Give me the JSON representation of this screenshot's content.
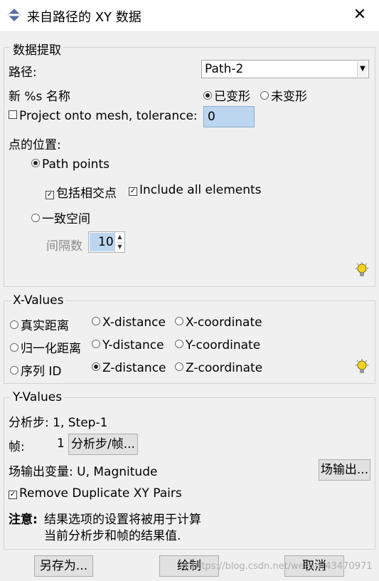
{
  "window": {
    "title": "来自路径的 XY 数据",
    "close": "✕"
  },
  "extract": {
    "legend": "数据提取",
    "path_label": "路径:",
    "path_value": "Path-2",
    "name_label": "新 %s 名称",
    "deformed": "已变形",
    "undeformed": "未变形",
    "project_label": "Project onto mesh, tolerance:",
    "tolerance": "0",
    "points_label": "点的位置:",
    "path_points": "Path points",
    "include_intersections": "包括相交点",
    "include_all_elements": "Include all elements",
    "uniform_spacing": "一致空间",
    "interval_label": "间隔数",
    "interval_value": "10"
  },
  "xvalues": {
    "legend": "X-Values",
    "options": [
      "真实距离",
      "X-distance",
      "X-coordinate",
      "归一化距离",
      "Y-distance",
      "Y-coordinate",
      "序列 ID",
      "Z-distance",
      "Z-coordinate"
    ],
    "selected": "Z-distance"
  },
  "yvalues": {
    "legend": "Y-Values",
    "step_text": "分析步: 1, Step-1",
    "frame_label": "帧:",
    "frame_value": "1",
    "step_frame_button": "分析步/帧...",
    "field_var_text": "场输出变量: U, Magnitude",
    "field_output_button": "场输出...",
    "remove_duplicates": "Remove Duplicate XY Pairs",
    "note_label": "注意:",
    "note_line1": "结果选项的设置将被用于计算",
    "note_line2": "当前分析步和帧的结果值."
  },
  "buttons": {
    "save_as": "另存为...",
    "plot": "绘制",
    "cancel": "取消"
  },
  "watermark": "https://blog.csdn.net/weixin_43470971",
  "colors": {
    "selection": "#bcd6f0",
    "bulb": "#f2d31f"
  }
}
